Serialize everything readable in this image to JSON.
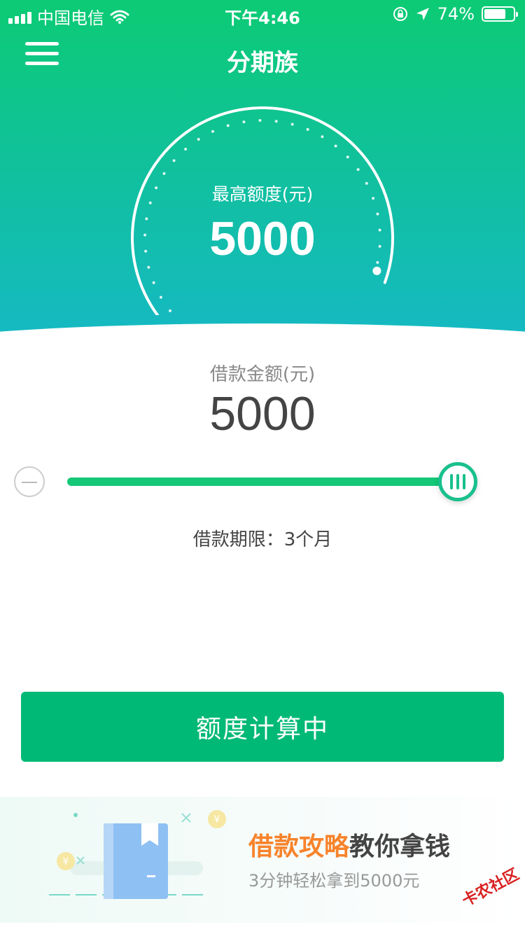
{
  "status_bar": {
    "carrier": "中国电信",
    "time": "下午4:46",
    "battery_percent": "74%",
    "battery_level": 0.74
  },
  "nav": {
    "title": "分期族"
  },
  "gauge": {
    "label": "最高额度(元)",
    "value": "5000",
    "fill_fraction": 1.0
  },
  "loan": {
    "amount_label": "借款金额(元)",
    "amount_value": "5000",
    "slider_fraction": 1.0,
    "term_text": "借款期限：3个月"
  },
  "primary_button": {
    "label": "额度计算中"
  },
  "banner": {
    "title_highlight": "借款攻略",
    "title_rest": "教你拿钱",
    "subtitle": "3分钟轻松拿到5000元"
  },
  "watermark": "卡农社区",
  "colors": {
    "brand_green": "#00b976",
    "accent_orange": "#f7832b",
    "gradient_top": "#0ccb74",
    "gradient_bottom": "#16b9c6"
  }
}
